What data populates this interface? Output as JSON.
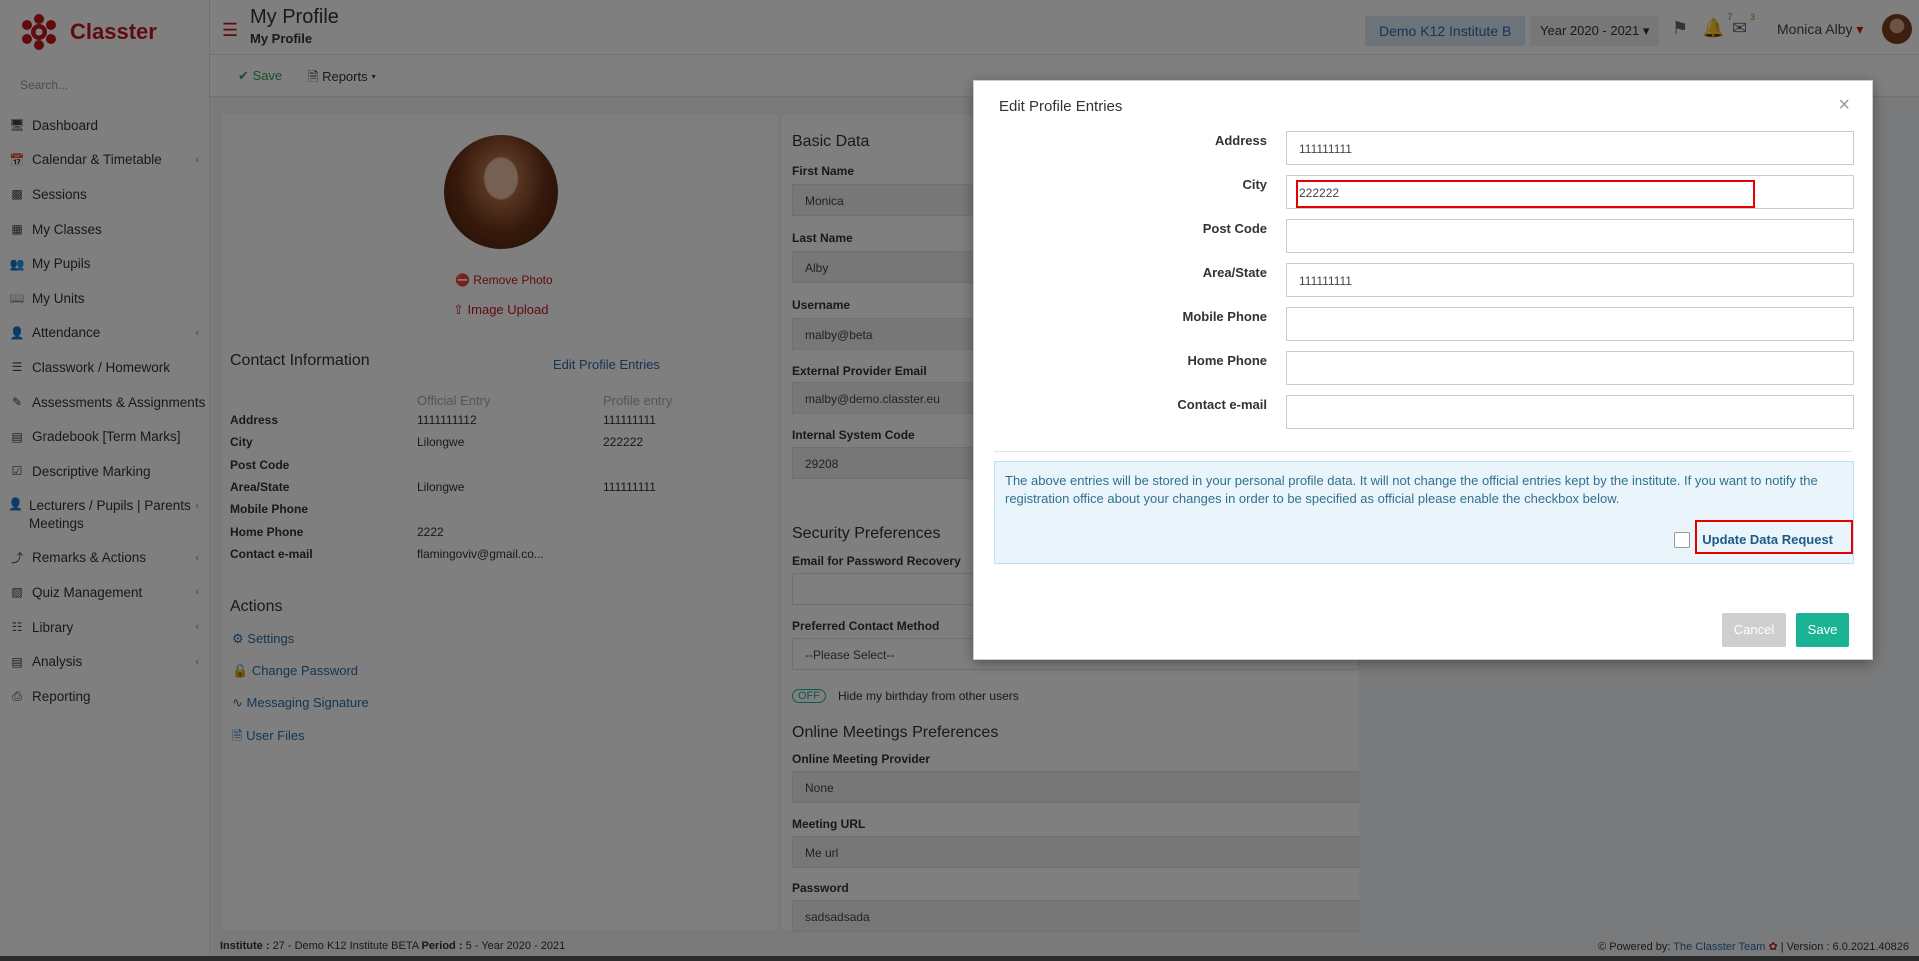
{
  "app": {
    "name": "Classter"
  },
  "sidebar": {
    "search_placeholder": "Search...",
    "items": [
      {
        "label": "Dashboard",
        "icon": "monitor-icon",
        "caret": false
      },
      {
        "label": "Calendar & Timetable",
        "icon": "calendar-icon",
        "caret": true
      },
      {
        "label": "Sessions",
        "icon": "sessions-icon",
        "caret": false
      },
      {
        "label": "My Classes",
        "icon": "classes-icon",
        "caret": false
      },
      {
        "label": "My Pupils",
        "icon": "users-icon",
        "caret": false
      },
      {
        "label": "My Units",
        "icon": "book-icon",
        "caret": false
      },
      {
        "label": "Attendance",
        "icon": "user-check-icon",
        "caret": true
      },
      {
        "label": "Classwork / Homework",
        "icon": "list-icon",
        "caret": false
      },
      {
        "label": "Assessments & Assignments",
        "icon": "edit-icon",
        "caret": false
      },
      {
        "label": "Gradebook [Term Marks]",
        "icon": "gradebook-icon",
        "caret": false
      },
      {
        "label": "Descriptive Marking",
        "icon": "marking-icon",
        "caret": false
      },
      {
        "label": "Lecturers / Pupils | Parents Meetings",
        "icon": "meetings-icon",
        "caret": true
      },
      {
        "label": "Remarks & Actions",
        "icon": "remarks-icon",
        "caret": true
      },
      {
        "label": "Quiz Management",
        "icon": "quiz-icon",
        "caret": true
      },
      {
        "label": "Library",
        "icon": "library-icon",
        "caret": true
      },
      {
        "label": "Analysis",
        "icon": "chart-icon",
        "caret": true
      },
      {
        "label": "Reporting",
        "icon": "printer-icon",
        "caret": false
      }
    ]
  },
  "header": {
    "title": "My Profile",
    "subtitle": "My Profile",
    "institute": "Demo K12 Institute B",
    "year": "Year 2020 - 2021",
    "notifications_count": "7",
    "messages_count": "3",
    "user_name": "Monica Alby"
  },
  "toolbar": {
    "save_label": "Save",
    "reports_label": "Reports"
  },
  "profile": {
    "remove_photo": "Remove Photo",
    "image_upload": "Image Upload",
    "contact_title": "Contact Information",
    "edit_entries": "Edit Profile Entries",
    "col_official": "Official Entry",
    "col_profile": "Profile entry",
    "rows": [
      {
        "label": "Address",
        "official": "1111111112",
        "profile": "111111111"
      },
      {
        "label": "City",
        "official": "Lilongwe",
        "profile": "222222"
      },
      {
        "label": "Post Code",
        "official": "",
        "profile": ""
      },
      {
        "label": "Area/State",
        "official": "Lilongwe",
        "profile": "111111111"
      },
      {
        "label": "Mobile Phone",
        "official": "",
        "profile": ""
      },
      {
        "label": "Home Phone",
        "official": "2222",
        "profile": ""
      },
      {
        "label": "Contact e-mail",
        "official": "flamingoviv@gmail.co...",
        "profile": ""
      }
    ],
    "actions_title": "Actions",
    "actions": [
      "Settings",
      "Change Password",
      "Messaging Signature",
      "User Files"
    ]
  },
  "basic": {
    "title": "Basic Data",
    "first_name_label": "First Name",
    "first_name": "Monica",
    "last_name_label": "Last Name",
    "last_name": "Alby",
    "username_label": "Username",
    "username": "malby@beta",
    "ext_email_label": "External Provider Email",
    "ext_email": "malby@demo.classter.eu",
    "sys_code_label": "Internal System Code",
    "sys_code": "29208"
  },
  "security": {
    "title": "Security Preferences",
    "recovery_label": "Email for Password Recovery",
    "contact_method_label": "Preferred Contact Method",
    "contact_method": "--Please Select--",
    "toggle": "OFF",
    "birthday_label": "Hide my birthday from other users"
  },
  "meetings": {
    "title": "Online Meetings Preferences",
    "provider_label": "Online Meeting Provider",
    "provider": "None",
    "url_label": "Meeting URL",
    "url": "Me url",
    "password_label": "Password",
    "password": "sadsadsada"
  },
  "modal": {
    "title": "Edit Profile Entries",
    "fields": [
      {
        "label": "Address",
        "value": "111111111"
      },
      {
        "label": "City",
        "value": "222222"
      },
      {
        "label": "Post Code",
        "value": ""
      },
      {
        "label": "Area/State",
        "value": "111111111"
      },
      {
        "label": "Mobile Phone",
        "value": ""
      },
      {
        "label": "Home Phone",
        "value": ""
      },
      {
        "label": "Contact e-mail",
        "value": ""
      }
    ],
    "info": "The above entries will be stored in your personal profile data. It will not change the official entries kept by the institute. If you want to notify the registration office about your changes in order to be specified as official please enable the checkbox below.",
    "checkbox_label": "Update Data Request",
    "checkbox_checked": false,
    "cancel": "Cancel",
    "save": "Save"
  },
  "footer": {
    "institute_label": "Institute :",
    "institute": "27 - Demo K12 Institute BETA",
    "period_label": "Period :",
    "period": "5 - Year 2020 - 2021",
    "powered_by": "Powered by:",
    "team": "The Classter Team",
    "version": "| Version : 6.0.2021.40826"
  },
  "colors": {
    "brand": "#c4161c",
    "accent": "#1ab394",
    "link": "#2b6aa6",
    "highlight": "#e60000"
  }
}
